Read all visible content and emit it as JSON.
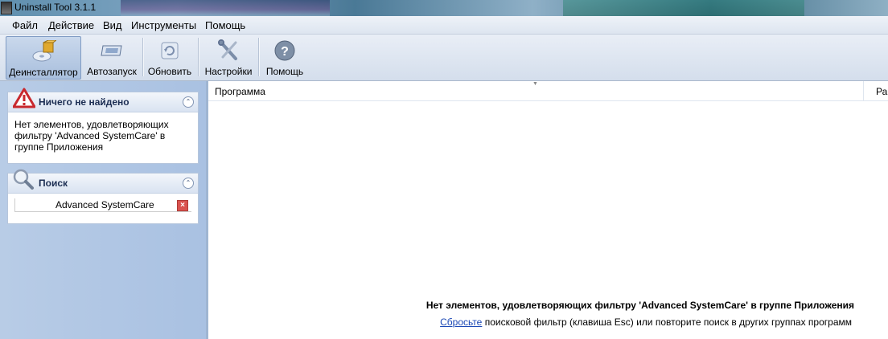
{
  "window": {
    "title": "Uninstall Tool 3.1.1"
  },
  "menu": [
    "Файл",
    "Действие",
    "Вид",
    "Инструменты",
    "Помощь"
  ],
  "toolbar": {
    "uninstaller": "Деинсталлятор",
    "autorun": "Автозапуск",
    "refresh": "Обновить",
    "settings": "Настройки",
    "help": "Помощь"
  },
  "sidebar": {
    "notfound": {
      "title": "Ничего не найдено",
      "body": "Нет элементов, удовлетворяющих фильтру 'Advanced SystemCare' в группе Приложения"
    },
    "search": {
      "title": "Поиск",
      "value": "Advanced SystemCare"
    }
  },
  "list": {
    "columns": [
      "Программа",
      "Ра"
    ],
    "empty_message": "Нет элементов, удовлетворяющих фильтру 'Advanced SystemCare' в группе Приложения",
    "reset_link": "Сбросьте",
    "reset_hint": " поисковой фильтр (клавиша Esc) или повторите поиск в других группах программ"
  },
  "colors": {
    "accent": "#1a47b5",
    "sidebar": "#b8cce6",
    "warning": "#c8282d"
  }
}
